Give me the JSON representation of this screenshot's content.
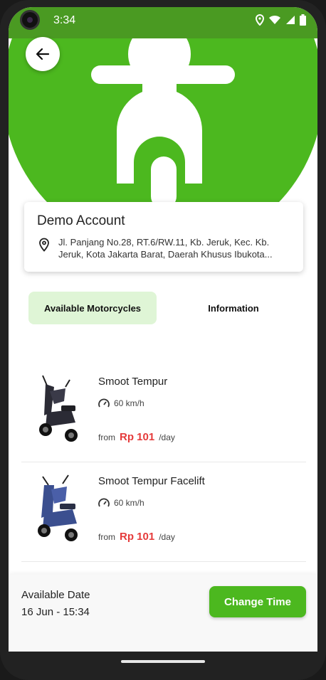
{
  "status_bar": {
    "time": "3:34",
    "icons": [
      "location-icon",
      "wifi-icon",
      "signal-icon",
      "battery-icon"
    ]
  },
  "header": {
    "back_icon": "arrow-left-icon",
    "hero_icon": "scooter-icon"
  },
  "account": {
    "name": "Demo Account",
    "address": "Jl. Panjang No.28, RT.6/RW.11, Kb. Jeruk, Kec. Kb. Jeruk, Kota Jakarta Barat, Daerah Khusus Ibukota..."
  },
  "tabs": [
    {
      "label": "Available Motorcycles",
      "active": true
    },
    {
      "label": "Information",
      "active": false
    }
  ],
  "motorcycles": [
    {
      "name": "Smoot Tempur",
      "speed": "60 km/h",
      "from_label": "from",
      "price": "Rp 101",
      "per": "/day",
      "color": "dark"
    },
    {
      "name": "Smoot Tempur Facelift",
      "speed": "60 km/h",
      "from_label": "from",
      "price": "Rp 101",
      "per": "/day",
      "color": "blue"
    }
  ],
  "footer": {
    "available_label": "Available Date",
    "available_value": "16 Jun - 15:34",
    "change_button": "Change Time"
  },
  "colors": {
    "brand_green": "#4cb81f",
    "price_red": "#e53b3b",
    "tab_active_bg": "#dff5d6"
  }
}
